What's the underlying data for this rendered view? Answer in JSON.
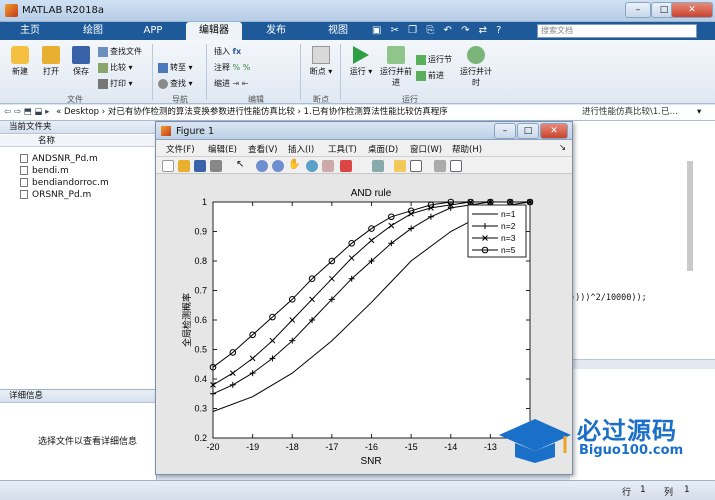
{
  "window": {
    "title": "MATLAB R2018a",
    "search_placeholder": "搜索文档"
  },
  "tabs": [
    {
      "label": "主页"
    },
    {
      "label": "绘图"
    },
    {
      "label": "APP"
    },
    {
      "label": "编辑器"
    },
    {
      "label": "发布"
    },
    {
      "label": "视图"
    }
  ],
  "ribbon": {
    "file": {
      "new": "新建",
      "open": "打开",
      "save": "保存",
      "find_files": "查找文件",
      "compare": "比较",
      "print": "打印",
      "group": "文件"
    },
    "nav": {
      "goto": "转至",
      "find": "查找",
      "group": "导航"
    },
    "edit": {
      "insert": "插入",
      "comment": "注释",
      "indent": "缩进",
      "fx": "fx",
      "group": "编辑"
    },
    "breakpoint": {
      "label": "断点",
      "group": "断点"
    },
    "run": {
      "run": "运行",
      "run_advance": "运行并前进",
      "run_section": "运行节",
      "advance": "前进",
      "run_time": "运行并计时",
      "group": "运行"
    }
  },
  "address": {
    "path": "« Desktop › 对已有协作检测的算法变换参数进行性能仿真比较 › 1.已有协作检测算法性能比较仿真程序",
    "right_text": "进行性能仿真比较\\1.已…"
  },
  "left": {
    "title": "当前文件夹",
    "col_name": "名称",
    "files": [
      "ANDSNR_Pd.m",
      "bendi.m",
      "bendiandorroc.m",
      "ORSNR_Pd.m"
    ]
  },
  "detail": {
    "title": "详细信息",
    "hint": "选择文件以查看详细信息"
  },
  "editor": {
    "code_fragment": "))))^2/10000));"
  },
  "status": {
    "row_label": "行",
    "row": "1",
    "col_label": "列",
    "col": "1"
  },
  "figure": {
    "title": "Figure 1",
    "menu": [
      "文件(F)",
      "编辑(E)",
      "查看(V)",
      "插入(I)",
      "工具(T)",
      "桌面(D)",
      "窗口(W)",
      "帮助(H)"
    ]
  },
  "watermark": {
    "main": "必过源码",
    "sub": "Biguo100.com"
  },
  "colors": {
    "tabbar": "#1e5a99",
    "accent": "#f0a020"
  },
  "chart_data": {
    "type": "line",
    "title": "AND rule",
    "xlabel": "SNR",
    "ylabel": "全局检测概率",
    "xlim": [
      -20,
      -12
    ],
    "ylim": [
      0.2,
      1
    ],
    "xticks": [
      -20,
      -19,
      -18,
      -17,
      -16,
      -15,
      -14,
      -13
    ],
    "yticks": [
      0.2,
      0.3,
      0.4,
      0.5,
      0.6,
      0.7,
      0.8,
      0.9,
      1
    ],
    "legend_position": "top-right",
    "series": [
      {
        "name": "n=1",
        "marker": "none",
        "x": [
          -20,
          -19,
          -18,
          -17,
          -16,
          -15,
          -14,
          -13,
          -12.5,
          -12
        ],
        "y": [
          0.29,
          0.34,
          0.42,
          0.53,
          0.66,
          0.8,
          0.9,
          0.97,
          0.99,
          1
        ]
      },
      {
        "name": "n=2",
        "marker": "plus",
        "x": [
          -20,
          -19.5,
          -19,
          -18.5,
          -18,
          -17.5,
          -17,
          -16.5,
          -16,
          -15.5,
          -15,
          -14.5,
          -14,
          -13.5,
          -13,
          -12.5,
          -12
        ],
        "y": [
          0.35,
          0.38,
          0.42,
          0.47,
          0.53,
          0.6,
          0.67,
          0.74,
          0.8,
          0.86,
          0.91,
          0.95,
          0.98,
          0.99,
          1,
          1,
          1
        ]
      },
      {
        "name": "n=3",
        "marker": "x",
        "x": [
          -20,
          -19.5,
          -19,
          -18.5,
          -18,
          -17.5,
          -17,
          -16.5,
          -16,
          -15.5,
          -15,
          -14.5,
          -14,
          -13.5,
          -13,
          -12.5,
          -12
        ],
        "y": [
          0.38,
          0.42,
          0.47,
          0.53,
          0.6,
          0.67,
          0.74,
          0.81,
          0.87,
          0.92,
          0.96,
          0.98,
          0.99,
          1,
          1,
          1,
          1
        ]
      },
      {
        "name": "n=5",
        "marker": "circle",
        "x": [
          -20,
          -19.5,
          -19,
          -18.5,
          -18,
          -17.5,
          -17,
          -16.5,
          -16,
          -15.5,
          -15,
          -14.5,
          -14,
          -13.5,
          -13,
          -12.5,
          -12
        ],
        "y": [
          0.44,
          0.49,
          0.55,
          0.61,
          0.67,
          0.74,
          0.8,
          0.86,
          0.91,
          0.95,
          0.97,
          0.99,
          1,
          1,
          1,
          1,
          1
        ]
      }
    ]
  }
}
